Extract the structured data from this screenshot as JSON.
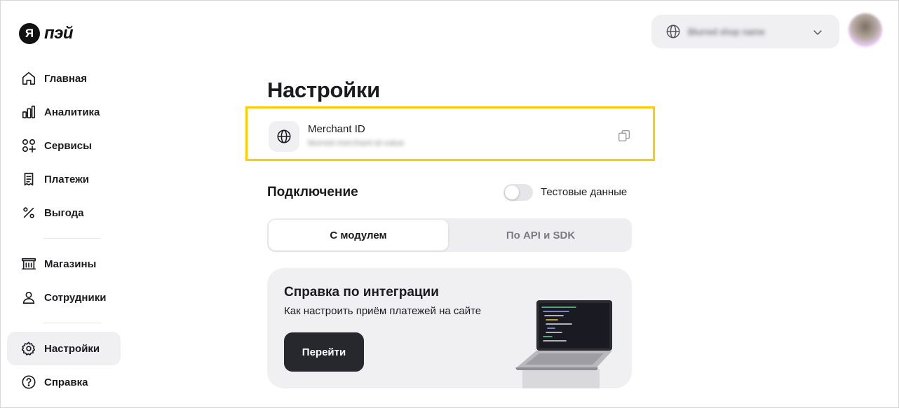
{
  "logo": {
    "mark": "Я",
    "text": "пэй"
  },
  "sidebar": {
    "items": [
      {
        "label": "Главная",
        "icon": "home-icon"
      },
      {
        "label": "Аналитика",
        "icon": "bar-chart-icon"
      },
      {
        "label": "Сервисы",
        "icon": "services-icon"
      },
      {
        "label": "Платежи",
        "icon": "receipt-icon"
      },
      {
        "label": "Выгода",
        "icon": "percent-icon"
      }
    ],
    "items2": [
      {
        "label": "Магазины",
        "icon": "store-icon"
      },
      {
        "label": "Сотрудники",
        "icon": "people-icon"
      }
    ],
    "items3": [
      {
        "label": "Настройки",
        "icon": "gear-icon",
        "active": true
      },
      {
        "label": "Справка",
        "icon": "help-icon"
      }
    ]
  },
  "header": {
    "account_name": "Blurred shop name"
  },
  "main": {
    "title": "Настройки",
    "merchant": {
      "label": "Merchant ID",
      "value": "blurred-merchant-id-value"
    },
    "connection": {
      "title": "Подключение",
      "test_toggle_label": "Тестовые данные",
      "test_toggle_on": false,
      "tabs": [
        {
          "label": "С модулем",
          "active": true
        },
        {
          "label": "По API и SDK",
          "active": false
        }
      ]
    },
    "help_card": {
      "title": "Справка по интеграции",
      "subtitle": "Как настроить приём платежей на сайте",
      "button": "Перейти"
    }
  },
  "colors": {
    "highlight_border": "#ffcc00",
    "primary_button": "#27272e",
    "surface": "#f0f0f3"
  }
}
